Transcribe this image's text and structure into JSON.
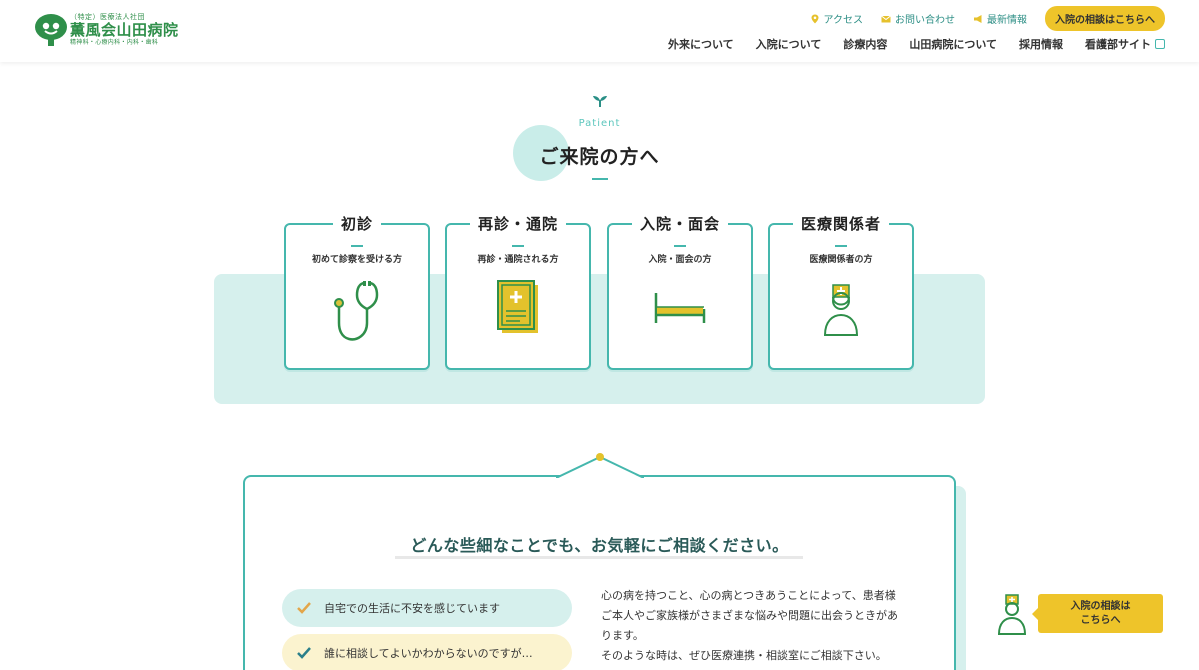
{
  "header": {
    "logo_sub": "（特定）医療法人社団",
    "logo_name": "薫風会山田病院",
    "logo_dept": "精神科・心療内科・内科・歯科",
    "util": [
      {
        "label": "アクセス",
        "icon": "map-pin-icon"
      },
      {
        "label": "お問い合わせ",
        "icon": "mail-icon"
      },
      {
        "label": "最新情報",
        "icon": "megaphone-icon"
      }
    ],
    "cta": "入院の相談はこちらへ",
    "nav": [
      "外来について",
      "入院について",
      "診療内容",
      "山田病院について",
      "採用情報",
      "看護部サイト"
    ]
  },
  "section": {
    "eyebrow": "Patient",
    "title": "ご来院の方へ"
  },
  "cards": [
    {
      "title": "初診",
      "sub": "初めて診察を受ける方",
      "icon": "stethoscope-icon"
    },
    {
      "title": "再診・通院",
      "sub": "再診・通院される方",
      "icon": "medical-record-icon"
    },
    {
      "title": "入院・面会",
      "sub": "入院・面会の方",
      "icon": "bed-icon"
    },
    {
      "title": "医療関係者",
      "sub": "医療関係者の方",
      "icon": "nurse-icon"
    }
  ],
  "consult": {
    "heading": "どんな些細なことでも、お気軽にご相談ください。",
    "checks": [
      "自宅での生活に不安を感じています",
      "誰に相談してよいかわからないのですが…"
    ],
    "paragraph_lines": [
      "心の病を持つこと、心の病とつきあうことによって、患者様",
      "ご本人やご家族様がさまざまな悩みや問題に出会うときがあ",
      "ります。",
      "そのような時は、ぜひ医療連携・相談室にご相談下さい。"
    ]
  },
  "float_cta": "入院の相談は\nこちらへ",
  "colors": {
    "teal": "#45b7ad",
    "yellow": "#eec42a",
    "green": "#2f8f4a",
    "mint": "#d6f0ed"
  }
}
